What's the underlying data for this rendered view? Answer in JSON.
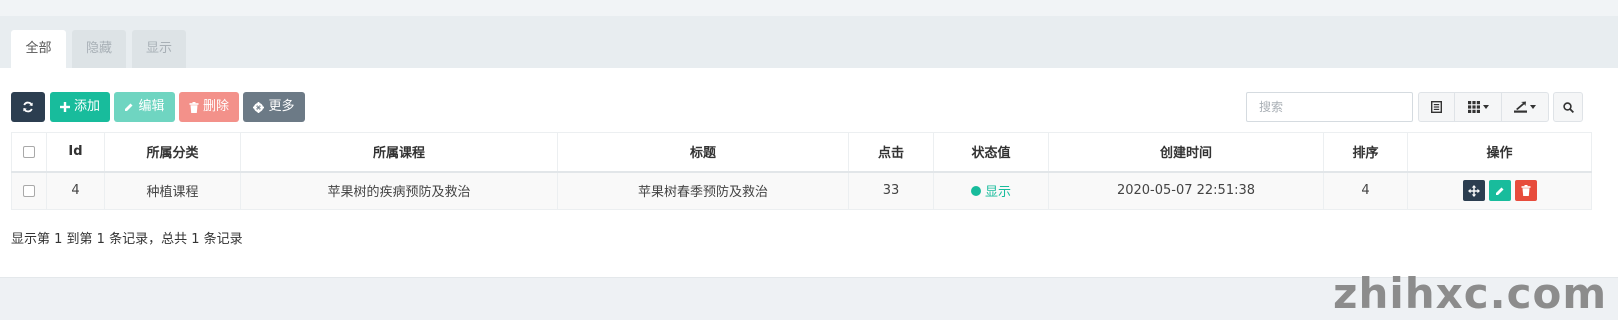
{
  "tabs": [
    {
      "label": "全部",
      "active": true
    },
    {
      "label": "隐藏",
      "active": false
    },
    {
      "label": "显示",
      "active": false
    }
  ],
  "toolbar": {
    "refresh_icon": "refresh-icon",
    "add_label": "添加",
    "edit_label": "编辑",
    "delete_label": "删除",
    "more_label": "更多",
    "search_placeholder": "搜索",
    "colors": {
      "refresh": "#2c3e50",
      "add": "#18bc9c",
      "edit": "#6fd5c1",
      "delete": "#f3918a",
      "more": "#6c7a86"
    }
  },
  "table": {
    "columns": [
      "Id",
      "所属分类",
      "所属课程",
      "标题",
      "点击",
      "状态值",
      "创建时间",
      "排序",
      "操作"
    ],
    "rows": [
      {
        "id": "4",
        "category": "种植课程",
        "course": "苹果树的疾病预防及救治",
        "title": "苹果树春季预防及救治",
        "clicks": "33",
        "status": "显示",
        "created": "2020-05-07 22:51:38",
        "sort": "4"
      }
    ]
  },
  "pagination": {
    "info": "显示第 1 到第 1 条记录，总共 1 条记录"
  },
  "watermark": "zhihxc.com"
}
